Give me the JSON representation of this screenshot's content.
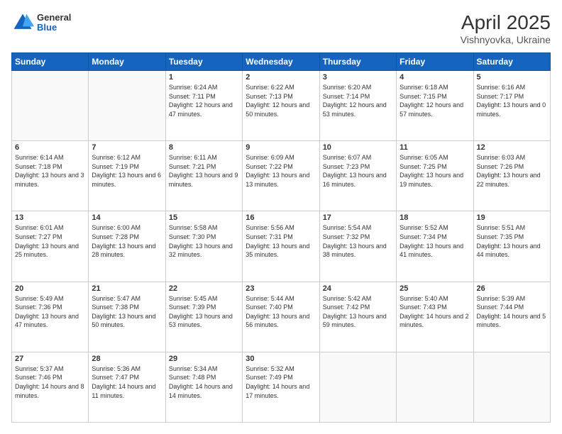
{
  "header": {
    "logo_general": "General",
    "logo_blue": "Blue",
    "title": "April 2025",
    "subtitle": "Vishnyovka, Ukraine"
  },
  "days_of_week": [
    "Sunday",
    "Monday",
    "Tuesday",
    "Wednesday",
    "Thursday",
    "Friday",
    "Saturday"
  ],
  "weeks": [
    [
      {
        "num": "",
        "sunrise": "",
        "sunset": "",
        "daylight": "",
        "empty": true
      },
      {
        "num": "",
        "sunrise": "",
        "sunset": "",
        "daylight": "",
        "empty": true
      },
      {
        "num": "1",
        "sunrise": "Sunrise: 6:24 AM",
        "sunset": "Sunset: 7:11 PM",
        "daylight": "Daylight: 12 hours and 47 minutes."
      },
      {
        "num": "2",
        "sunrise": "Sunrise: 6:22 AM",
        "sunset": "Sunset: 7:13 PM",
        "daylight": "Daylight: 12 hours and 50 minutes."
      },
      {
        "num": "3",
        "sunrise": "Sunrise: 6:20 AM",
        "sunset": "Sunset: 7:14 PM",
        "daylight": "Daylight: 12 hours and 53 minutes."
      },
      {
        "num": "4",
        "sunrise": "Sunrise: 6:18 AM",
        "sunset": "Sunset: 7:15 PM",
        "daylight": "Daylight: 12 hours and 57 minutes."
      },
      {
        "num": "5",
        "sunrise": "Sunrise: 6:16 AM",
        "sunset": "Sunset: 7:17 PM",
        "daylight": "Daylight: 13 hours and 0 minutes."
      }
    ],
    [
      {
        "num": "6",
        "sunrise": "Sunrise: 6:14 AM",
        "sunset": "Sunset: 7:18 PM",
        "daylight": "Daylight: 13 hours and 3 minutes."
      },
      {
        "num": "7",
        "sunrise": "Sunrise: 6:12 AM",
        "sunset": "Sunset: 7:19 PM",
        "daylight": "Daylight: 13 hours and 6 minutes."
      },
      {
        "num": "8",
        "sunrise": "Sunrise: 6:11 AM",
        "sunset": "Sunset: 7:21 PM",
        "daylight": "Daylight: 13 hours and 9 minutes."
      },
      {
        "num": "9",
        "sunrise": "Sunrise: 6:09 AM",
        "sunset": "Sunset: 7:22 PM",
        "daylight": "Daylight: 13 hours and 13 minutes."
      },
      {
        "num": "10",
        "sunrise": "Sunrise: 6:07 AM",
        "sunset": "Sunset: 7:23 PM",
        "daylight": "Daylight: 13 hours and 16 minutes."
      },
      {
        "num": "11",
        "sunrise": "Sunrise: 6:05 AM",
        "sunset": "Sunset: 7:25 PM",
        "daylight": "Daylight: 13 hours and 19 minutes."
      },
      {
        "num": "12",
        "sunrise": "Sunrise: 6:03 AM",
        "sunset": "Sunset: 7:26 PM",
        "daylight": "Daylight: 13 hours and 22 minutes."
      }
    ],
    [
      {
        "num": "13",
        "sunrise": "Sunrise: 6:01 AM",
        "sunset": "Sunset: 7:27 PM",
        "daylight": "Daylight: 13 hours and 25 minutes."
      },
      {
        "num": "14",
        "sunrise": "Sunrise: 6:00 AM",
        "sunset": "Sunset: 7:28 PM",
        "daylight": "Daylight: 13 hours and 28 minutes."
      },
      {
        "num": "15",
        "sunrise": "Sunrise: 5:58 AM",
        "sunset": "Sunset: 7:30 PM",
        "daylight": "Daylight: 13 hours and 32 minutes."
      },
      {
        "num": "16",
        "sunrise": "Sunrise: 5:56 AM",
        "sunset": "Sunset: 7:31 PM",
        "daylight": "Daylight: 13 hours and 35 minutes."
      },
      {
        "num": "17",
        "sunrise": "Sunrise: 5:54 AM",
        "sunset": "Sunset: 7:32 PM",
        "daylight": "Daylight: 13 hours and 38 minutes."
      },
      {
        "num": "18",
        "sunrise": "Sunrise: 5:52 AM",
        "sunset": "Sunset: 7:34 PM",
        "daylight": "Daylight: 13 hours and 41 minutes."
      },
      {
        "num": "19",
        "sunrise": "Sunrise: 5:51 AM",
        "sunset": "Sunset: 7:35 PM",
        "daylight": "Daylight: 13 hours and 44 minutes."
      }
    ],
    [
      {
        "num": "20",
        "sunrise": "Sunrise: 5:49 AM",
        "sunset": "Sunset: 7:36 PM",
        "daylight": "Daylight: 13 hours and 47 minutes."
      },
      {
        "num": "21",
        "sunrise": "Sunrise: 5:47 AM",
        "sunset": "Sunset: 7:38 PM",
        "daylight": "Daylight: 13 hours and 50 minutes."
      },
      {
        "num": "22",
        "sunrise": "Sunrise: 5:45 AM",
        "sunset": "Sunset: 7:39 PM",
        "daylight": "Daylight: 13 hours and 53 minutes."
      },
      {
        "num": "23",
        "sunrise": "Sunrise: 5:44 AM",
        "sunset": "Sunset: 7:40 PM",
        "daylight": "Daylight: 13 hours and 56 minutes."
      },
      {
        "num": "24",
        "sunrise": "Sunrise: 5:42 AM",
        "sunset": "Sunset: 7:42 PM",
        "daylight": "Daylight: 13 hours and 59 minutes."
      },
      {
        "num": "25",
        "sunrise": "Sunrise: 5:40 AM",
        "sunset": "Sunset: 7:43 PM",
        "daylight": "Daylight: 14 hours and 2 minutes."
      },
      {
        "num": "26",
        "sunrise": "Sunrise: 5:39 AM",
        "sunset": "Sunset: 7:44 PM",
        "daylight": "Daylight: 14 hours and 5 minutes."
      }
    ],
    [
      {
        "num": "27",
        "sunrise": "Sunrise: 5:37 AM",
        "sunset": "Sunset: 7:46 PM",
        "daylight": "Daylight: 14 hours and 8 minutes."
      },
      {
        "num": "28",
        "sunrise": "Sunrise: 5:36 AM",
        "sunset": "Sunset: 7:47 PM",
        "daylight": "Daylight: 14 hours and 11 minutes."
      },
      {
        "num": "29",
        "sunrise": "Sunrise: 5:34 AM",
        "sunset": "Sunset: 7:48 PM",
        "daylight": "Daylight: 14 hours and 14 minutes."
      },
      {
        "num": "30",
        "sunrise": "Sunrise: 5:32 AM",
        "sunset": "Sunset: 7:49 PM",
        "daylight": "Daylight: 14 hours and 17 minutes."
      },
      {
        "num": "",
        "sunrise": "",
        "sunset": "",
        "daylight": "",
        "empty": true
      },
      {
        "num": "",
        "sunrise": "",
        "sunset": "",
        "daylight": "",
        "empty": true
      },
      {
        "num": "",
        "sunrise": "",
        "sunset": "",
        "daylight": "",
        "empty": true
      }
    ]
  ]
}
